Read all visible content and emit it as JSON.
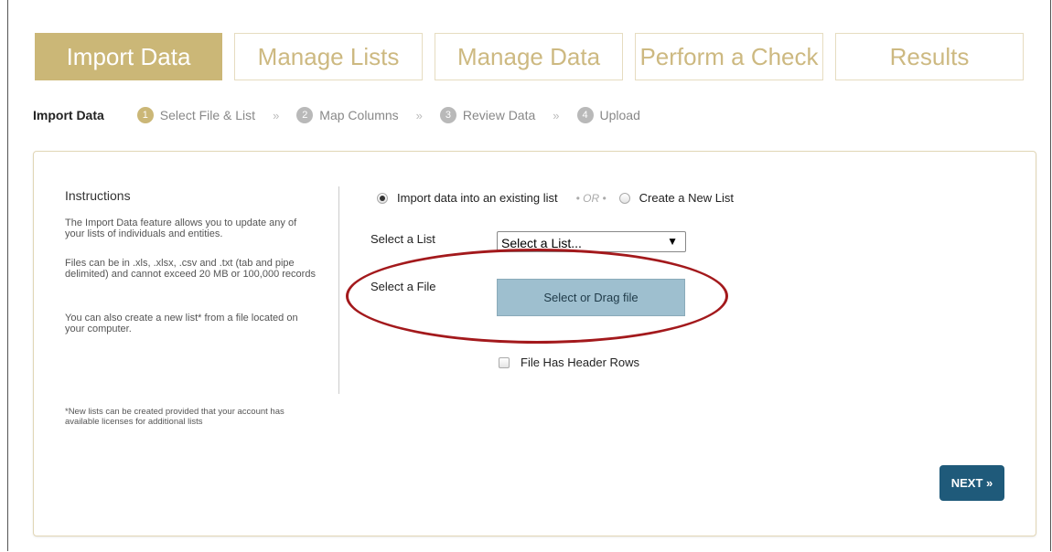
{
  "tabs": [
    {
      "label": "Import Data",
      "active": true
    },
    {
      "label": "Manage Lists",
      "active": false
    },
    {
      "label": "Manage Data",
      "active": false
    },
    {
      "label": "Perform a Check",
      "active": false
    },
    {
      "label": "Results",
      "active": false
    }
  ],
  "breadcrumb": {
    "lead": "Import Data",
    "separator": "»",
    "steps": [
      {
        "num": "1",
        "label": "Select File & List",
        "active": true
      },
      {
        "num": "2",
        "label": "Map Columns",
        "active": false
      },
      {
        "num": "3",
        "label": "Review Data",
        "active": false
      },
      {
        "num": "4",
        "label": "Upload",
        "active": false
      }
    ]
  },
  "instructions": {
    "title": "Instructions",
    "paragraphs": [
      "The Import Data feature allows you to update any of your lists of individuals and entities.",
      "Files can be in .xls, .xlsx, .csv and .txt (tab and pipe delimited) and cannot exceed 20 MB or 100,000 records",
      "You can also create a new list* from a file located on your computer."
    ],
    "note": "*New lists can be created provided that your account has available licenses for additional lists"
  },
  "form": {
    "radio_existing": "Import data into an existing list",
    "radio_existing_selected": true,
    "or_text": "• OR •",
    "radio_new": "Create a New List",
    "radio_new_selected": false,
    "list_label": "Select a List",
    "list_value": "Select a List...",
    "file_label": "Select a File",
    "file_button": "Select or Drag file",
    "header_rows_label": "File Has Header Rows",
    "header_rows_checked": false
  },
  "actions": {
    "next_label": "NEXT »"
  },
  "colors": {
    "tab_active": "#cbb777",
    "tab_text": "#cdb981",
    "file_button": "#9ebfcf",
    "next_button": "#1f5a7a",
    "annotation_ellipse": "#a3191c"
  }
}
